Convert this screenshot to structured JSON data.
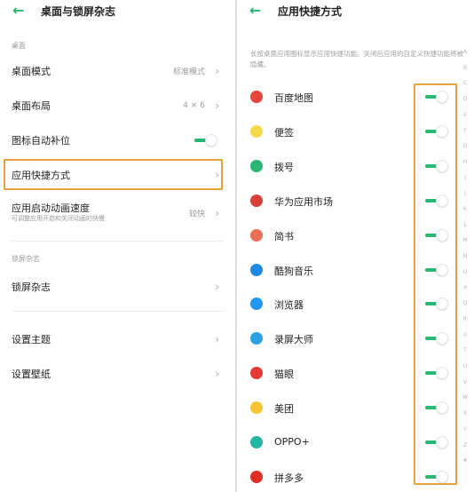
{
  "left": {
    "title": "桌面与锁屏杂志",
    "sections": {
      "desktop": "桌面",
      "lockscreen": "锁屏杂志"
    },
    "rows": {
      "desktop_mode": {
        "label": "桌面模式",
        "value": "标准模式"
      },
      "desktop_layout": {
        "label": "桌面布局",
        "value": "4 × 6"
      },
      "icon_autofill": {
        "label": "图标自动补位",
        "toggle_on": true
      },
      "app_shortcuts": {
        "label": "应用快捷方式"
      },
      "app_anim_speed": {
        "label": "应用启动动画速度",
        "sub": "可调整应用开启和关闭动画的快慢",
        "value": "较快"
      },
      "lock_mag": {
        "label": "锁屏杂志"
      },
      "set_theme": {
        "label": "设置主题"
      },
      "set_wallpaper": {
        "label": "设置壁纸"
      }
    }
  },
  "right": {
    "title": "应用快捷方式",
    "description": "长按桌面应用图标显示应用快捷功能。关闭后应用的自定义快捷功能将被隐藏。",
    "apps": [
      {
        "name": "百度地图",
        "icon": "baidu-map-icon",
        "color": "#e8453c",
        "on": true
      },
      {
        "name": "便签",
        "icon": "notes-icon",
        "color": "#f6d94a",
        "on": true
      },
      {
        "name": "拨号",
        "icon": "phone-icon",
        "color": "#2bb673",
        "on": true
      },
      {
        "name": "华为应用市场",
        "icon": "huawei-appmarket-icon",
        "color": "#d9403a",
        "on": true
      },
      {
        "name": "简书",
        "icon": "jianshu-icon",
        "color": "#ea6f5a",
        "on": true
      },
      {
        "name": "酷狗音乐",
        "icon": "kugou-icon",
        "color": "#1e88e5",
        "on": true
      },
      {
        "name": "浏览器",
        "icon": "browser-icon",
        "color": "#2196f3",
        "on": true
      },
      {
        "name": "录屏大师",
        "icon": "screen-recorder-icon",
        "color": "#29a3e0",
        "on": true
      },
      {
        "name": "猫眼",
        "icon": "maoyan-icon",
        "color": "#e53935",
        "on": true
      },
      {
        "name": "美团",
        "icon": "meituan-icon",
        "color": "#f7c531",
        "on": true
      },
      {
        "name": "OPPO+",
        "icon": "oppo-plus-icon",
        "color": "#26b5a4",
        "on": true
      },
      {
        "name": "拼多多",
        "icon": "pinduoduo-icon",
        "color": "#e02e24",
        "on": true
      }
    ],
    "alphabet": [
      "A",
      "B",
      "C",
      "D",
      "E",
      "F",
      "G",
      "H",
      "I",
      "J",
      "K",
      "L",
      "M",
      "N",
      "O",
      "P",
      "Q",
      "R",
      "S",
      "T",
      "U",
      "V",
      "W",
      "X",
      "Y",
      "Z",
      "#"
    ]
  },
  "colors": {
    "accent": "#2bb673",
    "highlight": "#e8a33d"
  }
}
